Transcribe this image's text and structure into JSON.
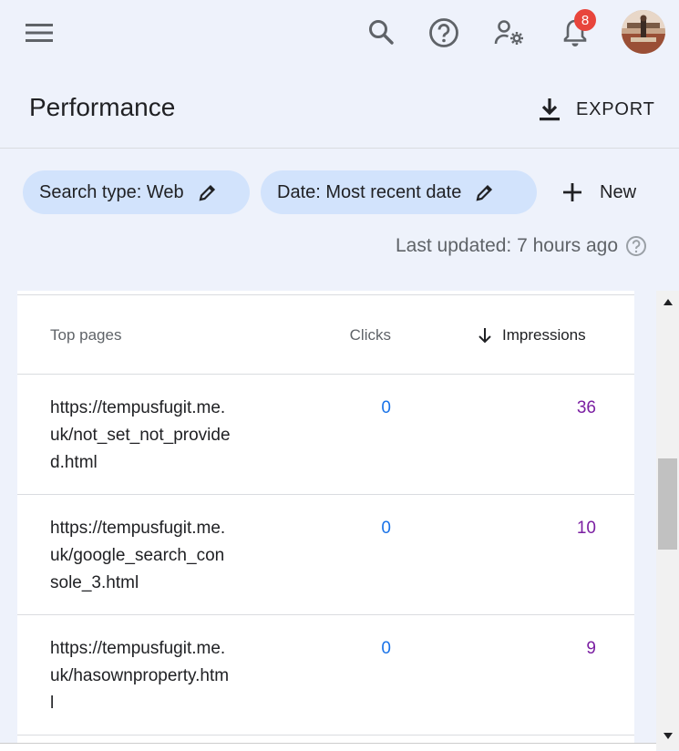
{
  "header": {
    "notifications_count": "8",
    "icons": [
      "menu-icon",
      "search-icon",
      "help-icon",
      "admin-icon",
      "bell-icon",
      "avatar"
    ]
  },
  "page": {
    "title": "Performance",
    "export_label": "EXPORT"
  },
  "filters": {
    "chips": [
      {
        "label": "Search type: Web"
      },
      {
        "label": "Date: Most recent date"
      }
    ],
    "new_label": "New",
    "last_updated": "Last updated: 7 hours ago"
  },
  "table": {
    "headers": {
      "pages": "Top pages",
      "clicks": "Clicks",
      "impressions": "Impressions"
    },
    "rows": [
      {
        "url": "https://tempusfugit.me.uk/not_set_not_provided.html",
        "clicks": "0",
        "impressions": "36"
      },
      {
        "url": "https://tempusfugit.me.uk/google_search_console_3.html",
        "clicks": "0",
        "impressions": "10"
      },
      {
        "url": "https://tempusfugit.me.uk/hasownproperty.html",
        "clicks": "0",
        "impressions": "9"
      }
    ]
  },
  "colors": {
    "background": "#eef2fb",
    "chip": "#d2e3fc",
    "clicks": "#1a73e8",
    "impressions": "#7b1fa2",
    "badge": "#e8453c"
  }
}
